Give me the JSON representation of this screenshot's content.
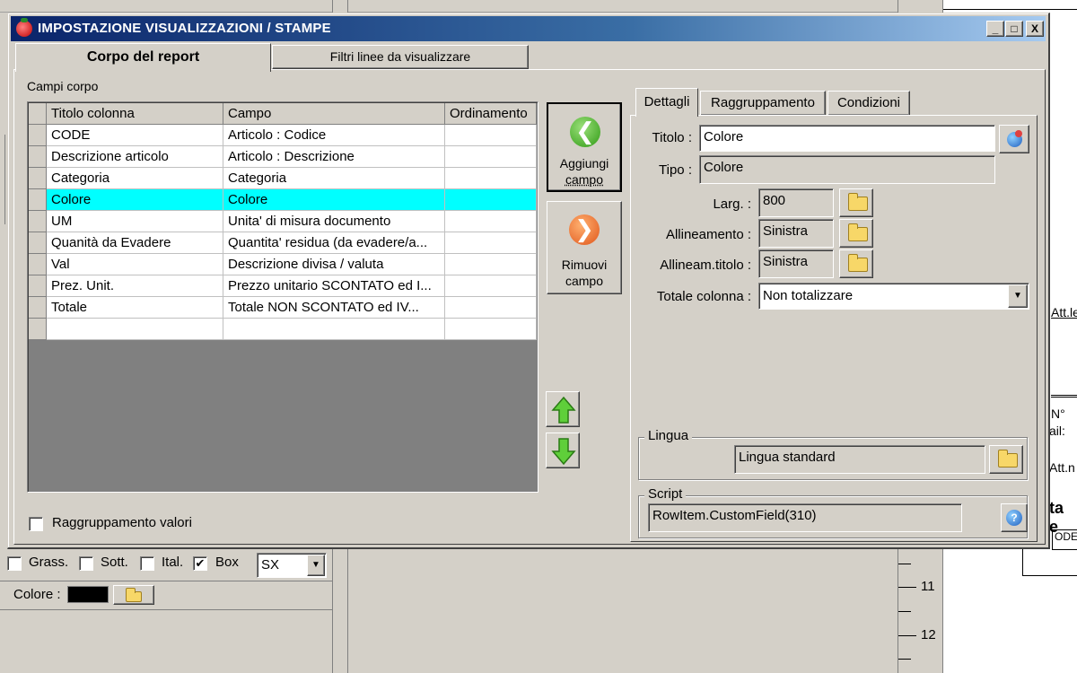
{
  "window": {
    "title": "IMPOSTAZIONE VISUALIZZAZIONI / STAMPE",
    "minimize": "_",
    "maximize": "□",
    "close": "X"
  },
  "main_tabs": [
    {
      "label": "Corpo del report",
      "active": true
    },
    {
      "label": "Filtri linee da visualizzare",
      "active": false
    }
  ],
  "fields_section": {
    "label": "Campi corpo",
    "columns": [
      "Titolo colonna",
      "Campo",
      "Ordinamento"
    ],
    "rows": [
      {
        "title": "CODE",
        "field": "Articolo : Codice",
        "order": ""
      },
      {
        "title": "Descrizione articolo",
        "field": "Articolo : Descrizione",
        "order": ""
      },
      {
        "title": "Categoria",
        "field": "Categoria",
        "order": ""
      },
      {
        "title": "Colore",
        "field": "Colore",
        "order": "",
        "selected": true
      },
      {
        "title": "UM",
        "field": "Unita' di misura documento",
        "order": ""
      },
      {
        "title": "Quanità da Evadere",
        "field": "Quantita' residua (da evadere/a...",
        "order": ""
      },
      {
        "title": "Val",
        "field": "Descrizione divisa / valuta",
        "order": ""
      },
      {
        "title": "Prez. Unit.",
        "field": "Prezzo unitario SCONTATO ed I...",
        "order": ""
      },
      {
        "title": "Totale",
        "field": "Totale NON SCONTATO ed IV...",
        "order": ""
      },
      {
        "title": "",
        "field": "",
        "order": ""
      }
    ],
    "group_values_label": "Raggruppamento valori"
  },
  "actions": {
    "add_line1": "Aggiungi",
    "add_line2": "campo",
    "remove_line1": "Rimuovi",
    "remove_line2": "campo"
  },
  "detail_tabs": [
    {
      "label": "Dettagli",
      "active": true
    },
    {
      "label": "Raggruppamento",
      "active": false
    },
    {
      "label": "Condizioni",
      "active": false
    }
  ],
  "details": {
    "titolo_label": "Titolo :",
    "titolo_value": "Colore",
    "tipo_label": "Tipo :",
    "tipo_value": "Colore",
    "larg_label": "Larg. :",
    "larg_value": "800",
    "allineamento_label": "Allineamento :",
    "allineamento_value": "Sinistra",
    "allineam_titolo_label": "Allineam.titolo :",
    "allineam_titolo_value": "Sinistra",
    "totale_label": "Totale colonna :",
    "totale_value": "Non totalizzare",
    "lingua_legend": "Lingua",
    "lingua_value": "Lingua standard",
    "script_legend": "Script",
    "script_value": "RowItem.CustomField(310)"
  },
  "bottom_toolbar": {
    "bold_label": "Grass.",
    "underline_label": "Sott.",
    "italic_label": "Ital.",
    "box_label": "Box",
    "box_checked": "✔",
    "align_value": "SX",
    "color_label": "Colore :",
    "color_value": "#000000"
  },
  "ruler": {
    "mark_11": "11",
    "mark_12": "12"
  },
  "page_fragments": {
    "att1": "Att.le",
    "n": "N°",
    "ail": "ail:",
    "att2": "Att.n",
    "ta": "ta e",
    "ode": "ODE"
  },
  "colors": {
    "titlebar_start": "#0a246a",
    "titlebar_end": "#a6caf0",
    "selection": "#00ffff",
    "window_bg": "#d4d0c8",
    "grid_empty": "#808080"
  }
}
